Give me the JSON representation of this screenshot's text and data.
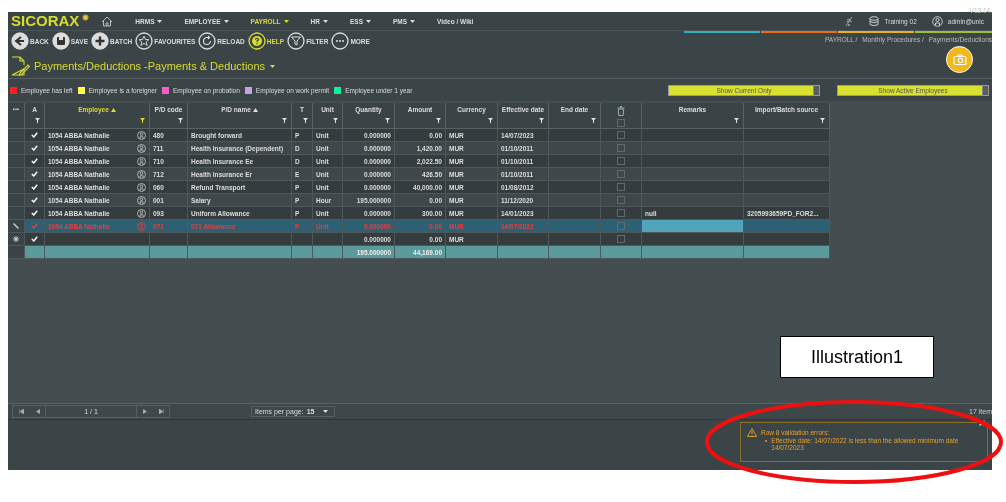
{
  "app": {
    "logo": "SICORAX",
    "version": "V13.14."
  },
  "nav": [
    {
      "label": "HRMS",
      "has_menu": true,
      "selected": false
    },
    {
      "label": "EMPLOYEE",
      "has_menu": true,
      "selected": false
    },
    {
      "label": "PAYROLL",
      "has_menu": true,
      "selected": true
    },
    {
      "label": "HR",
      "has_menu": true,
      "selected": false
    },
    {
      "label": "ESS",
      "has_menu": true,
      "selected": false
    },
    {
      "label": "PMS",
      "has_menu": true,
      "selected": false
    },
    {
      "label": "Video / Wiki",
      "has_menu": false,
      "selected": false
    }
  ],
  "status": {
    "database": "Training 02",
    "user": "admin@unic"
  },
  "toolbar": [
    {
      "kind": "back",
      "label": "BACK",
      "highlighted": false
    },
    {
      "kind": "save",
      "label": "SAVE",
      "highlighted": false
    },
    {
      "kind": "batch",
      "label": "BATCH",
      "highlighted": false
    },
    {
      "kind": "favourites",
      "label": "FAVOURITES",
      "highlighted": false
    },
    {
      "kind": "reload",
      "label": "RELOAD",
      "highlighted": false
    },
    {
      "kind": "help",
      "label": "HELP",
      "highlighted": true
    },
    {
      "kind": "filter",
      "label": "FILTER",
      "highlighted": false
    },
    {
      "kind": "more",
      "label": "MORE",
      "highlighted": false
    }
  ],
  "breadcrumb": [
    "PAYROLL /",
    "Monthly Procedures /",
    "Payments/Deductions"
  ],
  "page_title": "Payments/Deductions -Payments & Deductions",
  "legend": [
    {
      "label": "Employee has left",
      "color": "#ff2020"
    },
    {
      "label": "Employee is a foreigner",
      "color": "#ffff50"
    },
    {
      "label": "Employee on probation",
      "color": "#ff5ccc"
    },
    {
      "label": "Employee on work permit",
      "color": "#c8a0e8"
    },
    {
      "label": "Employee under 1 year",
      "color": "#10f090"
    }
  ],
  "toggles": [
    "Show Current Only",
    "Show Active Employees"
  ],
  "table": {
    "columns": [
      {
        "kind": "menu",
        "label": "•••"
      },
      {
        "kind": "text",
        "label": "A",
        "sorted": false,
        "filtered": false
      },
      {
        "kind": "text",
        "label": "Employee",
        "sorted": true,
        "filtered": true
      },
      {
        "kind": "text",
        "label": "P/D code",
        "sorted": false,
        "filtered": false
      },
      {
        "kind": "text",
        "label": "P/D name",
        "sorted": true,
        "filtered": false
      },
      {
        "kind": "text",
        "label": "T",
        "sorted": false,
        "filtered": false
      },
      {
        "kind": "text",
        "label": "Unit",
        "sorted": false,
        "filtered": false
      },
      {
        "kind": "text",
        "label": "Quantity",
        "sorted": false,
        "filtered": false
      },
      {
        "kind": "text",
        "label": "Amount",
        "sorted": false,
        "filtered": false
      },
      {
        "kind": "text",
        "label": "Currency",
        "sorted": false,
        "filtered": false
      },
      {
        "kind": "text",
        "label": "Effective date",
        "sorted": false,
        "filtered": false
      },
      {
        "kind": "text",
        "label": "End date",
        "sorted": false,
        "filtered": false
      },
      {
        "kind": "delete",
        "checked": false
      },
      {
        "kind": "text",
        "label": "Remarks",
        "sorted": false,
        "filtered": false
      },
      {
        "kind": "text",
        "label": "Import/Batch source",
        "sorted": false,
        "filtered": false
      }
    ],
    "rows": [
      {
        "kind": "data",
        "selected": false,
        "error": false,
        "active": true,
        "employee": "1054 ABBA Nathalie",
        "pd_code": "480",
        "pd_name": "Brought forward",
        "type": "P",
        "unit": "Unit",
        "quantity": "0.000000",
        "amount": "0.00",
        "currency": "MUR",
        "effective_date": "14/07/2023",
        "delete": false
      },
      {
        "kind": "data",
        "selected": false,
        "error": false,
        "active": true,
        "employee": "1054 ABBA Nathalie",
        "pd_code": "711",
        "pd_name": "Health Insurance (Dependent)",
        "type": "D",
        "unit": "Unit",
        "quantity": "0.000000",
        "amount": "1,420.00",
        "currency": "MUR",
        "effective_date": "01/10/2011",
        "delete": false
      },
      {
        "kind": "data",
        "selected": false,
        "error": false,
        "active": true,
        "employee": "1054 ABBA Nathalie",
        "pd_code": "710",
        "pd_name": "Health Insurance Ee",
        "type": "D",
        "unit": "Unit",
        "quantity": "0.000000",
        "amount": "2,022.50",
        "currency": "MUR",
        "effective_date": "01/10/2011",
        "delete": false
      },
      {
        "kind": "data",
        "selected": false,
        "error": false,
        "active": true,
        "employee": "1054 ABBA Nathalie",
        "pd_code": "712",
        "pd_name": "Health Insurance Er",
        "type": "E",
        "unit": "Unit",
        "quantity": "0.000000",
        "amount": "426.50",
        "currency": "MUR",
        "effective_date": "01/10/2011",
        "delete": false
      },
      {
        "kind": "data",
        "selected": false,
        "error": false,
        "active": true,
        "employee": "1054 ABBA Nathalie",
        "pd_code": "060",
        "pd_name": "Refund Transport",
        "type": "P",
        "unit": "Unit",
        "quantity": "0.000000",
        "amount": "40,000.00",
        "currency": "MUR",
        "effective_date": "01/08/2012",
        "delete": false
      },
      {
        "kind": "data",
        "selected": false,
        "error": false,
        "active": true,
        "employee": "1054 ABBA Nathalie",
        "pd_code": "001",
        "pd_name": "Salary",
        "type": "P",
        "unit": "Hour",
        "quantity": "195.000000",
        "amount": "0.00",
        "currency": "MUR",
        "effective_date": "11/12/2020",
        "delete": false
      },
      {
        "kind": "data",
        "selected": false,
        "error": false,
        "active": true,
        "employee": "1054 ABBA Nathalie",
        "pd_code": "093",
        "pd_name": "Uniform Allowance",
        "type": "P",
        "unit": "Unit",
        "quantity": "0.000000",
        "amount": "300.00",
        "currency": "MUR",
        "effective_date": "14/01/2023",
        "delete": false,
        "remarks": "null",
        "import_source": "3205993659PD_FOR2..."
      },
      {
        "kind": "edit",
        "selected": true,
        "error": true,
        "active": true,
        "remarks_focused": true,
        "employee": "1054 ABBA Nathalie",
        "pd_code": "071",
        "pd_name": "071 Allowance",
        "type": "P",
        "unit": "Unit",
        "quantity": "0.000000",
        "amount": "0.00",
        "currency": "MUR",
        "effective_date": "14/07/2022",
        "delete": false
      },
      {
        "kind": "new",
        "selected": false,
        "error": false,
        "active": true,
        "quantity": "0.000000",
        "amount": "0.00",
        "currency": "MUR",
        "delete": false
      },
      {
        "kind": "total",
        "quantity": "195.000000",
        "amount": "44,169.00"
      }
    ]
  },
  "pager": {
    "page": "1 / 1",
    "items_per_page_label": "Items per page:",
    "items_per_page": "15",
    "count": "17 item"
  },
  "notification": {
    "title": "Row 8 validation errors:",
    "messages": [
      {
        "bullet": "•",
        "text": "Effective date: 14/07/2022 is less than the allowed minimum date 14/07/2023"
      }
    ]
  },
  "annotation": {
    "label": "Illustration1"
  }
}
